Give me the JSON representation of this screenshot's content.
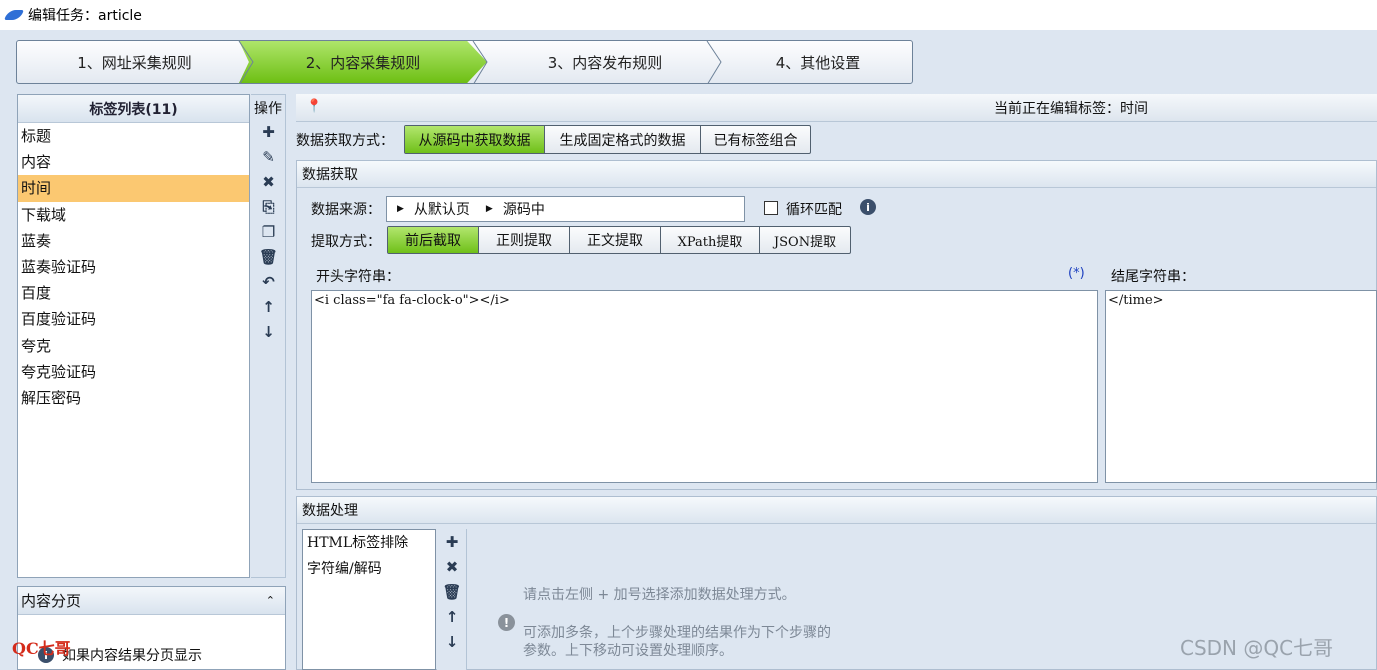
{
  "window": {
    "title": "编辑任务：article"
  },
  "steps": [
    {
      "label": "1、网址采集规则"
    },
    {
      "label": "2、内容采集规则"
    },
    {
      "label": "3、内容发布规则"
    },
    {
      "label": "4、其他设置"
    }
  ],
  "tags": {
    "header": "标签列表(11)",
    "items": [
      "标题",
      "内容",
      "时间",
      "下载域",
      "蓝奏",
      "蓝奏验证码",
      "百度",
      "百度验证码",
      "夸克",
      "夸克验证码",
      "解压密码"
    ],
    "selected": "时间"
  },
  "ops": {
    "label": "操作"
  },
  "paging": {
    "header": "内容分页",
    "text": "如果内容结果分页显示"
  },
  "logo": {
    "text": "QC七哥"
  },
  "editing": {
    "text": "当前正在编辑标签：时间"
  },
  "getmode": {
    "label": "数据获取方式：",
    "options": [
      "从源码中获取数据",
      "生成固定格式的数据",
      "已有标签组合"
    ],
    "selected": "从源码中获取数据"
  },
  "fetch": {
    "header": "数据获取",
    "source_label": "数据来源：",
    "source_segments": [
      "从默认页",
      "源码中"
    ],
    "loop_label": "循环匹配",
    "extract_label": "提取方式：",
    "extract_options": [
      "前后截取",
      "正则提取",
      "正文提取",
      "XPath提取",
      "JSON提取"
    ],
    "extract_selected": "前后截取",
    "start_label": "开头字符串：",
    "start_marker": "(*)",
    "start_value": "<i class=\"fa fa-clock-o\"></i>",
    "end_label": "结尾字符串：",
    "end_value": "</time>"
  },
  "process": {
    "header": "数据处理",
    "items": [
      "HTML标签排除",
      "字符编/解码"
    ],
    "hint1": "请点击左侧 + 加号选择添加数据处理方式。",
    "hint2": "可添加多条，上个步骤处理的结果作为下个步骤的",
    "hint3": "参数。上下移动可设置处理顺序。"
  },
  "watermark": {
    "text": "CSDN @QC七哥"
  },
  "colors": {
    "accent_green": "#7ccb22",
    "selected_row": "#fbc871",
    "background": "#dde6f1"
  }
}
